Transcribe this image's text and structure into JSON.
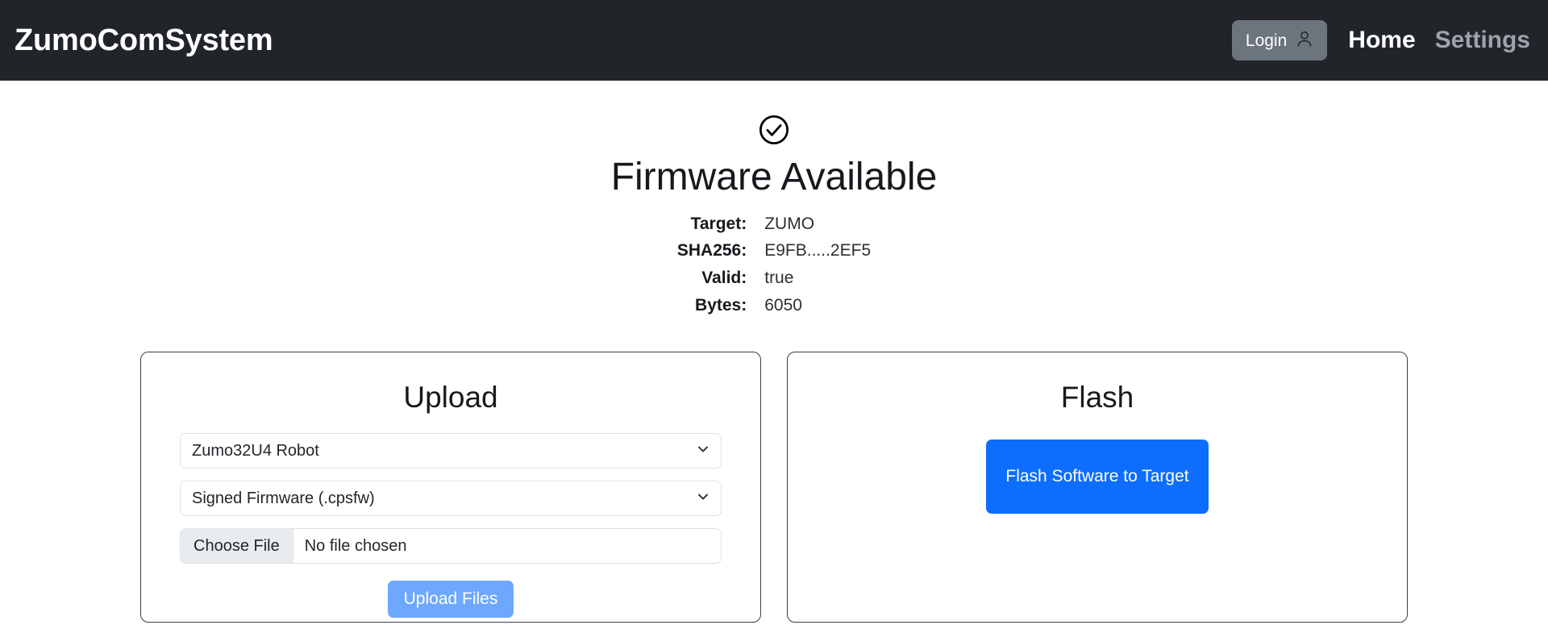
{
  "header": {
    "brand": "ZumoComSystem",
    "login_label": "Login",
    "login_icon": "person-icon",
    "nav": [
      {
        "label": "Home",
        "active": true
      },
      {
        "label": "Settings",
        "active": false
      }
    ]
  },
  "status": {
    "icon": "check-circle-icon",
    "title": "Firmware Available",
    "details": [
      {
        "label": "Target:",
        "value": "ZUMO"
      },
      {
        "label": "SHA256:",
        "value": "E9FB.....2EF5"
      },
      {
        "label": "Valid:",
        "value": "true"
      },
      {
        "label": "Bytes:",
        "value": "6050"
      }
    ]
  },
  "upload_card": {
    "title": "Upload",
    "device_select": {
      "value": "Zumo32U4 Robot",
      "icon": "chevron-down-icon"
    },
    "type_select": {
      "value": "Signed Firmware (.cpsfw)",
      "icon": "chevron-down-icon"
    },
    "file_input": {
      "button_label": "Choose File",
      "file_name": "No file chosen"
    },
    "submit_label": "Upload Files"
  },
  "flash_card": {
    "title": "Flash",
    "button_label": "Flash Software to Target"
  },
  "colors": {
    "navbar_bg": "#212529",
    "login_bg": "#6c757d",
    "primary_blue": "#0d6efd",
    "disabled_blue": "#6ea8fe",
    "file_btn_bg": "#e9ecef",
    "card_border": "#3a3f44"
  }
}
